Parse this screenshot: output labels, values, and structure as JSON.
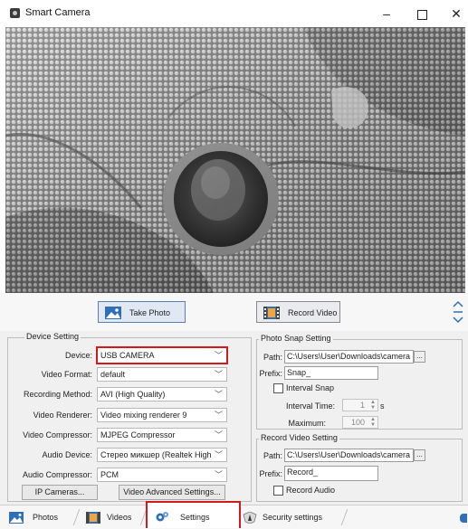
{
  "window": {
    "title": "Smart Camera",
    "minimize_glyph": "–",
    "close_glyph": "✕"
  },
  "actions": {
    "take_photo": "Take Photo",
    "record_video": "Record Video"
  },
  "device_setting": {
    "title": "Device Setting",
    "device_label": "Device:",
    "device_value": "USB CAMERA",
    "video_format_label": "Video Format:",
    "video_format_value": "default",
    "recording_method_label": "Recording Method:",
    "recording_method_value": "AVI (High Quality)",
    "video_renderer_label": "Video Renderer:",
    "video_renderer_value": "Video mixing renderer 9",
    "video_compressor_label": "Video Compressor:",
    "video_compressor_value": "MJPEG Compressor",
    "audio_device_label": "Audio Device:",
    "audio_device_value": "Стерео микшер (Realtek High",
    "audio_compressor_label": "Audio Compressor:",
    "audio_compressor_value": "PCM",
    "ip_cameras_button": "IP Cameras...",
    "video_advanced_button": "Video Advanced Settings..."
  },
  "photo_snap": {
    "title": "Photo Snap Setting",
    "path_label": "Path:",
    "path_value": "C:\\Users\\User\\Downloads\\camera",
    "browse_label": "...",
    "prefix_label": "Prefix:",
    "prefix_value": "Snap_",
    "interval_snap_label": "Interval Snap",
    "interval_time_label": "Interval Time:",
    "interval_time_value": "1",
    "interval_time_unit": "s",
    "maximum_label": "Maximum:",
    "maximum_value": "100"
  },
  "record_video": {
    "title": "Record Video Setting",
    "path_label": "Path:",
    "path_value": "C:\\Users\\User\\Downloads\\camera",
    "browse_label": "...",
    "prefix_label": "Prefix:",
    "prefix_value": "Record_",
    "record_audio_label": "Record Audio"
  },
  "tabs": [
    {
      "label": "Photos"
    },
    {
      "label": "Videos"
    },
    {
      "label": "Settings"
    },
    {
      "label": "Security settings"
    }
  ],
  "colors": {
    "highlight_red": "#d21a1a",
    "accent_blue": "#2f6fb7"
  }
}
